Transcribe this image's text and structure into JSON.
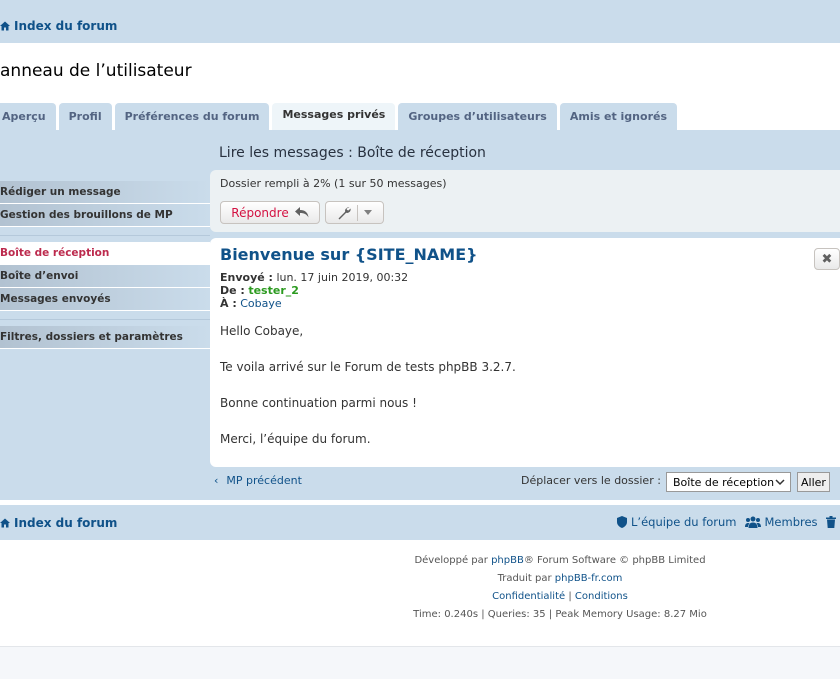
{
  "nav": {
    "home_label": "Index du forum"
  },
  "panel": {
    "title": "anneau de l’utilisateur"
  },
  "tabs": [
    {
      "label": "Aperçu"
    },
    {
      "label": "Profil"
    },
    {
      "label": "Préférences du forum"
    },
    {
      "label": "Messages privés"
    },
    {
      "label": "Groupes d’utilisateurs"
    },
    {
      "label": "Amis et ignorés"
    }
  ],
  "sidebar": {
    "group1": [
      "Rédiger un message",
      "Gestion des brouillons de MP"
    ],
    "group2": [
      "Boîte de réception",
      "Boîte d’envoi",
      "Messages envoyés"
    ],
    "group3": [
      "Filtres, dossiers et paramètres"
    ]
  },
  "content": {
    "title": "Lire les messages : Boîte de réception",
    "folder_info": "Dossier rempli à 2% (1 sur 50 messages)",
    "reply_label": "Répondre"
  },
  "message": {
    "subject": "Bienvenue sur {SITE_NAME}",
    "sent_label": "Envoyé :",
    "sent_value": "lun. 17 juin 2019, 00:32",
    "from_label": "De :",
    "from_value": "tester_2",
    "to_label": "À :",
    "to_value": "Cobaye",
    "body": [
      "Hello Cobaye,",
      "Te voila arrivé sur le Forum de tests phpBB 3.2.7.",
      "Bonne continuation parmi nous !",
      "Merci, l’équipe du forum."
    ]
  },
  "bottom": {
    "prev_label": "MP précédent",
    "move_label": "Déplacer vers le dossier :",
    "move_selected": "Boîte de réception",
    "go_label": "Aller"
  },
  "footer": {
    "home_label": "Index du forum",
    "team_label": "L’équipe du forum",
    "members_label": "Membres",
    "delete_label": "S",
    "line1_pre": "Développé par",
    "line1_link": "phpBB",
    "line1_post": "® Forum Software © phpBB Limited",
    "line2_pre": "Traduit par",
    "line2_link": "phpBB-fr.com",
    "privacy": "Confidentialité",
    "sep": "|",
    "terms": "Conditions",
    "stats": "Time: 0.240s | Queries: 35 | Peak Memory Usage: 8.27 Mio"
  },
  "colors": {
    "accent": "#105289",
    "active_red": "#bc2a4d",
    "panel_bg": "#cadceb"
  }
}
